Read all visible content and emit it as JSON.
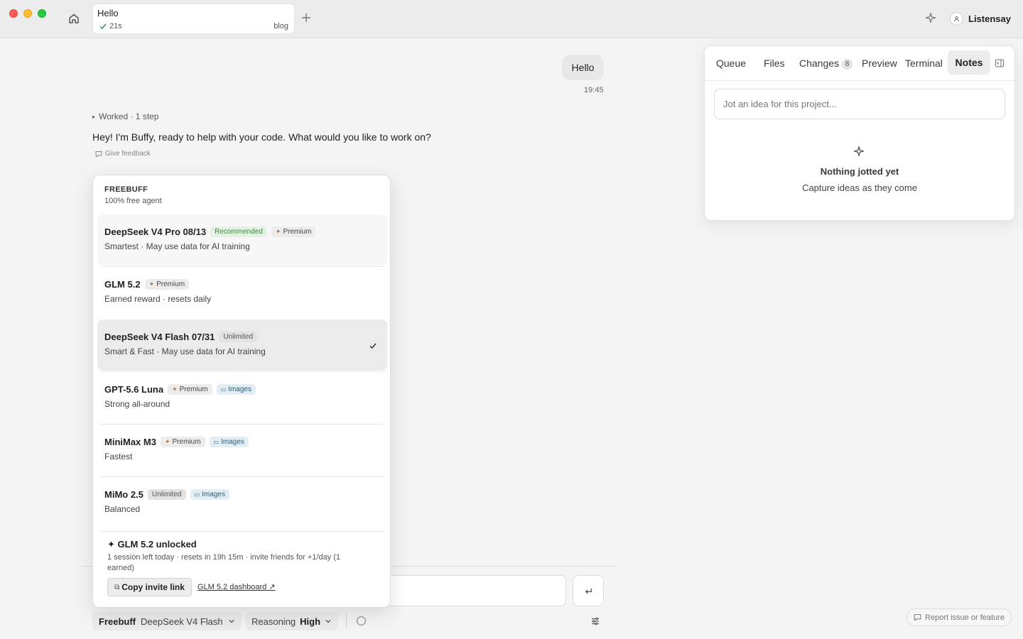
{
  "titlebar": {
    "tab": {
      "title": "Hello",
      "duration": "21s",
      "label": "blog"
    },
    "user": {
      "name": "Listensay"
    }
  },
  "chat": {
    "user_message": "Hello",
    "user_message_time": "19:45",
    "worked_summary": "Worked · 1 step",
    "assistant_message": "Hey! I'm Buffy, ready to help with your code. What would you like to work on?",
    "feedback_label": "Give feedback"
  },
  "panel": {
    "tabs": [
      {
        "label": "Queue"
      },
      {
        "label": "Files"
      },
      {
        "label": "Changes",
        "badge": "8"
      },
      {
        "label": "Preview"
      },
      {
        "label": "Terminal"
      },
      {
        "label": "Notes",
        "active": true
      }
    ],
    "note_placeholder": "Jot an idea for this project...",
    "empty_title": "Nothing jotted yet",
    "empty_subtitle": "Capture ideas as they come"
  },
  "dropdown": {
    "title": "FREEBUFF",
    "subtitle": "100% free agent",
    "options": [
      {
        "name": "DeepSeek V4 Pro 08/13",
        "badges": [
          "Recommended",
          "Premium"
        ],
        "desc": "Smartest · May use data for AI training"
      },
      {
        "name": "GLM 5.2",
        "badges": [
          "Premium"
        ],
        "desc": "Earned reward · resets daily"
      },
      {
        "name": "DeepSeek V4 Flash 07/31",
        "badges": [
          "Unlimited"
        ],
        "desc": "Smart & Fast · May use data for AI training",
        "selected": true
      },
      {
        "name": "GPT-5.6 Luna",
        "badges": [
          "Premium",
          "Images"
        ],
        "desc": "Strong all-around"
      },
      {
        "name": "MiniMax M3",
        "badges": [
          "Premium",
          "Images"
        ],
        "desc": "Fastest"
      },
      {
        "name": "MiMo 2.5",
        "badges": [
          "Unlimited",
          "Images"
        ],
        "desc": "Balanced"
      }
    ],
    "unlock": {
      "title": "✦ GLM 5.2 unlocked",
      "info": "1 session left today · resets in 19h 15m · invite friends for +1/day (1 earned)",
      "invite_button": "Copy invite link",
      "dashboard_link": "GLM 5.2 dashboard ↗"
    }
  },
  "composer": {
    "model_brand": "Freebuff",
    "model_name": "DeepSeek V4 Flash",
    "reasoning_label": "Reasoning",
    "reasoning_value": "High",
    "report_label": "Report issue or feature"
  },
  "colors": {
    "recommended_text": "#3a8a3a",
    "recommended_bg": "#e4f2e4",
    "images_text": "#2b5c75",
    "images_bg": "#e3eef4",
    "selected_row_bg": "#ebebeb"
  },
  "icons": {
    "home": "home-icon",
    "add_tab": "plus-icon",
    "sparkle": "sparkle-icon",
    "avatar": "user-icon",
    "collapse": "sidebar-collapse-icon",
    "send": "enter-icon",
    "settings": "sliders-icon",
    "spinner": "loading-icon",
    "check": "check-icon"
  }
}
